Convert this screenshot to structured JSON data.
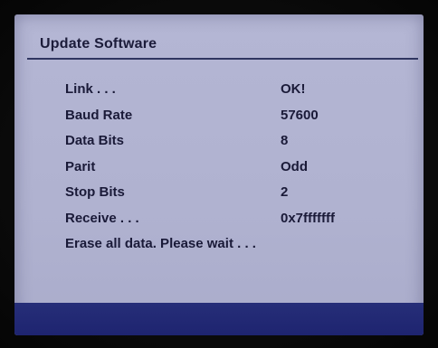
{
  "screen": {
    "title": "Update Software",
    "rows": [
      {
        "label": "Link . . .",
        "value": "OK!"
      },
      {
        "label": "Baud Rate",
        "value": "57600"
      },
      {
        "label": "Data Bits",
        "value": "8"
      },
      {
        "label": "Parit",
        "value": "Odd"
      },
      {
        "label": "Stop Bits",
        "value": "2"
      },
      {
        "label": "Receive . . .",
        "value": "0x7fffffff"
      }
    ],
    "message": "Erase all data. Please wait . . ."
  },
  "colors": {
    "background": "#b2b4d2",
    "text": "#1a1a38",
    "rule": "#2f3560",
    "footer": "#222a74"
  }
}
